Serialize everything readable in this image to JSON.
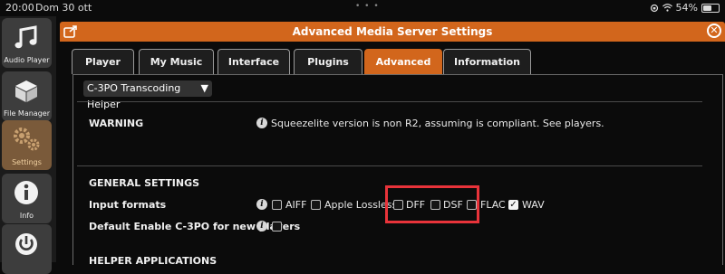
{
  "status_bar": {
    "time": "20:00",
    "date": "Dom 30 ott",
    "battery": "54%",
    "battery_level": 0.54
  },
  "sidebar": {
    "items": [
      {
        "label": "Audio Player",
        "icon": "music-note-icon",
        "active": false
      },
      {
        "label": "File Manager",
        "icon": "box-icon",
        "active": false
      },
      {
        "label": "Settings",
        "icon": "gears-icon",
        "active": true
      },
      {
        "label": "Info",
        "icon": "info-icon",
        "active": false
      },
      {
        "label": "",
        "icon": "power-icon",
        "active": false
      }
    ]
  },
  "window": {
    "title": "Advanced Media Server Settings",
    "tabs": [
      {
        "label": "Player",
        "active": false
      },
      {
        "label": "My Music",
        "active": false
      },
      {
        "label": "Interface",
        "active": false
      },
      {
        "label": "Plugins",
        "active": false
      },
      {
        "label": "Advanced",
        "active": true
      },
      {
        "label": "Information",
        "active": false
      }
    ],
    "plugin_select": "C-3PO Transcoding Helper",
    "warning": {
      "label": "WARNING",
      "message": "Squeezelite version is non R2, assuming is compliant. See players."
    },
    "general_settings": {
      "heading": "GENERAL SETTINGS",
      "input_formats_label": "Input formats",
      "formats": [
        {
          "label": "AIFF",
          "checked": false
        },
        {
          "label": "Apple Lossless",
          "checked": false
        },
        {
          "label": "DFF",
          "checked": false
        },
        {
          "label": "DSF",
          "checked": false
        },
        {
          "label": "FLAC",
          "checked": false
        },
        {
          "label": "WAV",
          "checked": true
        }
      ],
      "default_enable_label": "Default Enable C-3PO for new players",
      "default_enable_checked": false
    },
    "helper_heading": "HELPER APPLICATIONS"
  },
  "colors": {
    "accent": "#d2661c",
    "highlight": "#e8333a"
  }
}
